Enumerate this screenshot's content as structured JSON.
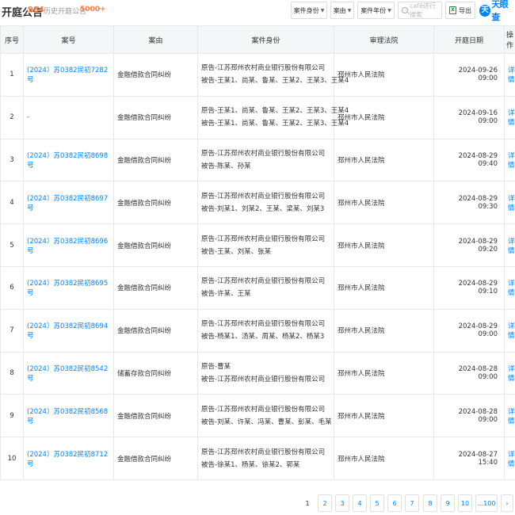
{
  "header": {
    "title": "开庭公告",
    "count": "984",
    "history_label": "历史开庭公告",
    "history_count": "5000+",
    "history_arrow": "›",
    "filters": [
      {
        "label": "案件身份"
      },
      {
        "label": "案由"
      },
      {
        "label": "案件年份"
      }
    ],
    "search_placeholder": "café进行搜索",
    "export_label": "导出",
    "export_icon": "xls-icon",
    "logo_mark": "天",
    "logo_text": "天眼查"
  },
  "table": {
    "columns": [
      "序号",
      "案号",
      "案由",
      "案件身份",
      "审理法院",
      "开庭日期",
      "操作"
    ],
    "rows": [
      {
        "no": "1",
        "case_no": "(2024）苏0382民初7282号",
        "cause": "金融借款合同纠纷",
        "plaintiff": "原告-江苏邳州农村商业银行股份有限公司",
        "defendant": "被告-王某1、尚某、鲁某、王某2、王某3、王某4",
        "court": "邳州市人民法院",
        "date": "2024-09-26 09:00",
        "op": "详情"
      },
      {
        "no": "2",
        "case_no": "-",
        "cause": "金融借款合同纠纷",
        "plaintiff": "原告-王某1、尚某、鲁某、王某2、王某3、王某4",
        "defendant": "被告-王某1、尚某、鲁某、王某2、王某3、王某4",
        "court": "邳州市人民法院",
        "date": "2024-09-16 09:00",
        "op": "详情"
      },
      {
        "no": "3",
        "case_no": "(2024）苏0382民初8698号",
        "cause": "金融借款合同纠纷",
        "plaintiff": "原告-江苏邳州农村商业银行股份有限公司",
        "defendant": "被告-陈某、孙某",
        "court": "邳州市人民法院",
        "date": "2024-08-29 09:40",
        "op": "详情"
      },
      {
        "no": "4",
        "case_no": "(2024）苏0382民初8697号",
        "cause": "金融借款合同纠纷",
        "plaintiff": "原告-江苏邳州农村商业银行股份有限公司",
        "defendant": "被告-刘某1、刘某2、王某、梁某、刘某3",
        "court": "邳州市人民法院",
        "date": "2024-08-29 09:30",
        "op": "详情"
      },
      {
        "no": "5",
        "case_no": "(2024）苏0382民初8696号",
        "cause": "金融借款合同纠纷",
        "plaintiff": "原告-江苏邳州农村商业银行股份有限公司",
        "defendant": "被告-王某、刘某、张某",
        "court": "邳州市人民法院",
        "date": "2024-08-29 09:20",
        "op": "详情"
      },
      {
        "no": "6",
        "case_no": "(2024）苏0382民初8695号",
        "cause": "金融借款合同纠纷",
        "plaintiff": "原告-江苏邳州农村商业银行股份有限公司",
        "defendant": "被告-许某、王某",
        "court": "邳州市人民法院",
        "date": "2024-08-29 09:10",
        "op": "详情"
      },
      {
        "no": "7",
        "case_no": "(2024）苏0382民初8694号",
        "cause": "金融借款合同纠纷",
        "plaintiff": "原告-江苏邳州农村商业银行股份有限公司",
        "defendant": "被告-杨某1、汤某、周某、杨某2、杨某3",
        "court": "邳州市人民法院",
        "date": "2024-08-29 09:00",
        "op": "详情"
      },
      {
        "no": "8",
        "case_no": "(2024）苏0382民初8542号",
        "cause": "储蓄存款合同纠纷",
        "plaintiff": "原告-曹某",
        "defendant": "被告-江苏邳州农村商业银行股份有限公司",
        "court": "邳州市人民法院",
        "date": "2024-08-28 09:00",
        "op": "详情"
      },
      {
        "no": "9",
        "case_no": "(2024）苏0382民初8568号",
        "cause": "金融借款合同纠纷",
        "plaintiff": "原告-江苏邳州农村商业银行股份有限公司",
        "defendant": "被告-刘某、许某、冯某、曹某、彭某、毛某",
        "court": "邳州市人民法院",
        "date": "2024-08-28 09:00",
        "op": "详情"
      },
      {
        "no": "10",
        "case_no": "(2024）苏0382民初8712号",
        "cause": "金融借款合同纠纷",
        "plaintiff": "原告-江苏邳州农村商业银行股份有限公司",
        "defendant": "被告-徐某1、杨某、徐某2、郭某",
        "court": "邳州市人民法院",
        "date": "2024-08-27 15:40",
        "op": "详情"
      }
    ]
  },
  "pagination": {
    "pages": [
      "1",
      "2",
      "3",
      "4",
      "5",
      "6",
      "7",
      "8",
      "9",
      "10",
      "...100"
    ],
    "current": "1",
    "next": "›"
  }
}
